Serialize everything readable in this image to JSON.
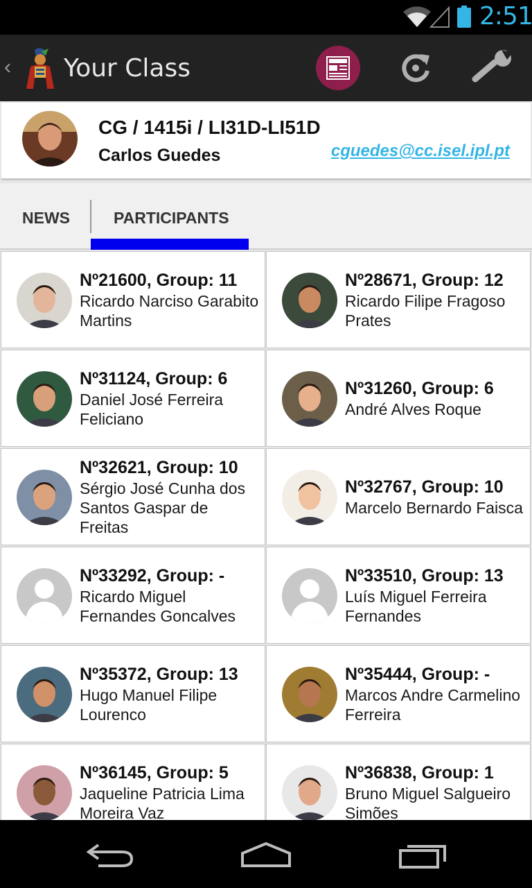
{
  "status_bar": {
    "time": "2:51",
    "accent_color": "#33b5e5"
  },
  "action_bar": {
    "title": "Your Class",
    "icons": [
      "up-caret-icon",
      "app-logo-icon",
      "news-icon",
      "refresh-icon",
      "settings-wrench-icon"
    ],
    "news_button_color": "#8e1f4c"
  },
  "class_header": {
    "class_code": "CG / 1415i / LI31D-LI51D",
    "teacher_name": "Carlos Guedes",
    "teacher_email": "cguedes@cc.isel.ipl.pt"
  },
  "tabs": [
    {
      "label": "NEWS",
      "selected": false
    },
    {
      "label": "PARTICIPANTS",
      "selected": true
    }
  ],
  "tab_indicator_color": "#0000ee",
  "participants": [
    {
      "number": "Nº21600, Group: 11",
      "name": "Ricardo Narciso Garabito Martins",
      "avatar": "photo"
    },
    {
      "number": "Nº28671, Group: 12",
      "name": "Ricardo Filipe Fragoso Prates",
      "avatar": "photo"
    },
    {
      "number": "Nº31124, Group: 6",
      "name": "Daniel José Ferreira Feliciano",
      "avatar": "photo"
    },
    {
      "number": "Nº31260, Group: 6",
      "name": "André Alves Roque",
      "avatar": "photo"
    },
    {
      "number": "Nº32621, Group: 10",
      "name": "Sérgio José Cunha dos Santos Gaspar de Freitas",
      "avatar": "photo"
    },
    {
      "number": "Nº32767, Group: 10",
      "name": "Marcelo Bernardo Faisca",
      "avatar": "photo"
    },
    {
      "number": "Nº33292, Group: -",
      "name": "Ricardo Miguel Fernandes Goncalves",
      "avatar": "placeholder"
    },
    {
      "number": "Nº33510, Group: 13",
      "name": "Luís Miguel Ferreira Fernandes",
      "avatar": "placeholder"
    },
    {
      "number": "Nº35372, Group: 13",
      "name": "Hugo Manuel Filipe Lourenco",
      "avatar": "photo"
    },
    {
      "number": "Nº35444, Group: -",
      "name": "Marcos Andre Carmelino Ferreira",
      "avatar": "photo"
    },
    {
      "number": "Nº36145, Group: 5",
      "name": "Jaqueline Patricia Lima Moreira Vaz",
      "avatar": "photo"
    },
    {
      "number": "Nº36838, Group: 1",
      "name": "Bruno Miguel Salgueiro Simões",
      "avatar": "photo"
    }
  ],
  "nav_bar": {
    "icons": [
      "back-icon",
      "home-icon",
      "recent-apps-icon"
    ]
  }
}
